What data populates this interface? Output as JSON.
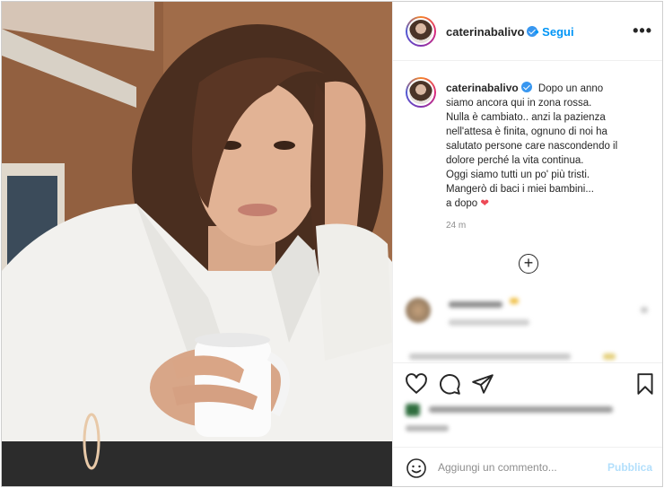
{
  "post": {
    "username": "caterinabalivo",
    "follow_label": "Segui",
    "more_icon": "more-options-icon",
    "caption": {
      "username": "caterinabalivo",
      "text": "Dopo un anno\nsiamo ancora qui in zona rossa.\nNulla è cambiato.. anzi la pazienza\nnell'attesa è finita, ognuno di noi ha\nsalutato persone care nascondendo il\ndolore perché la vita continua.\nOggi siamo tutti un po' più tristi.\nMangerò di baci i miei bambini...\na dopo",
      "emoji": "❤"
    },
    "time_ago": "24 m",
    "load_more_icon": "plus-circle-icon"
  },
  "actions": {
    "like_icon": "heart-icon",
    "comment_icon": "comment-icon",
    "share_icon": "share-icon",
    "save_icon": "bookmark-icon"
  },
  "comment_bar": {
    "placeholder": "Aggiungi un commento...",
    "publish_label": "Pubblica",
    "emoji_icon": "smiley-icon"
  },
  "colors": {
    "accent": "#0095f6",
    "verified": "#3897f0",
    "publish_disabled": "#b2dffc",
    "heart": "#ed4956",
    "muted": "#8e8e8e"
  }
}
